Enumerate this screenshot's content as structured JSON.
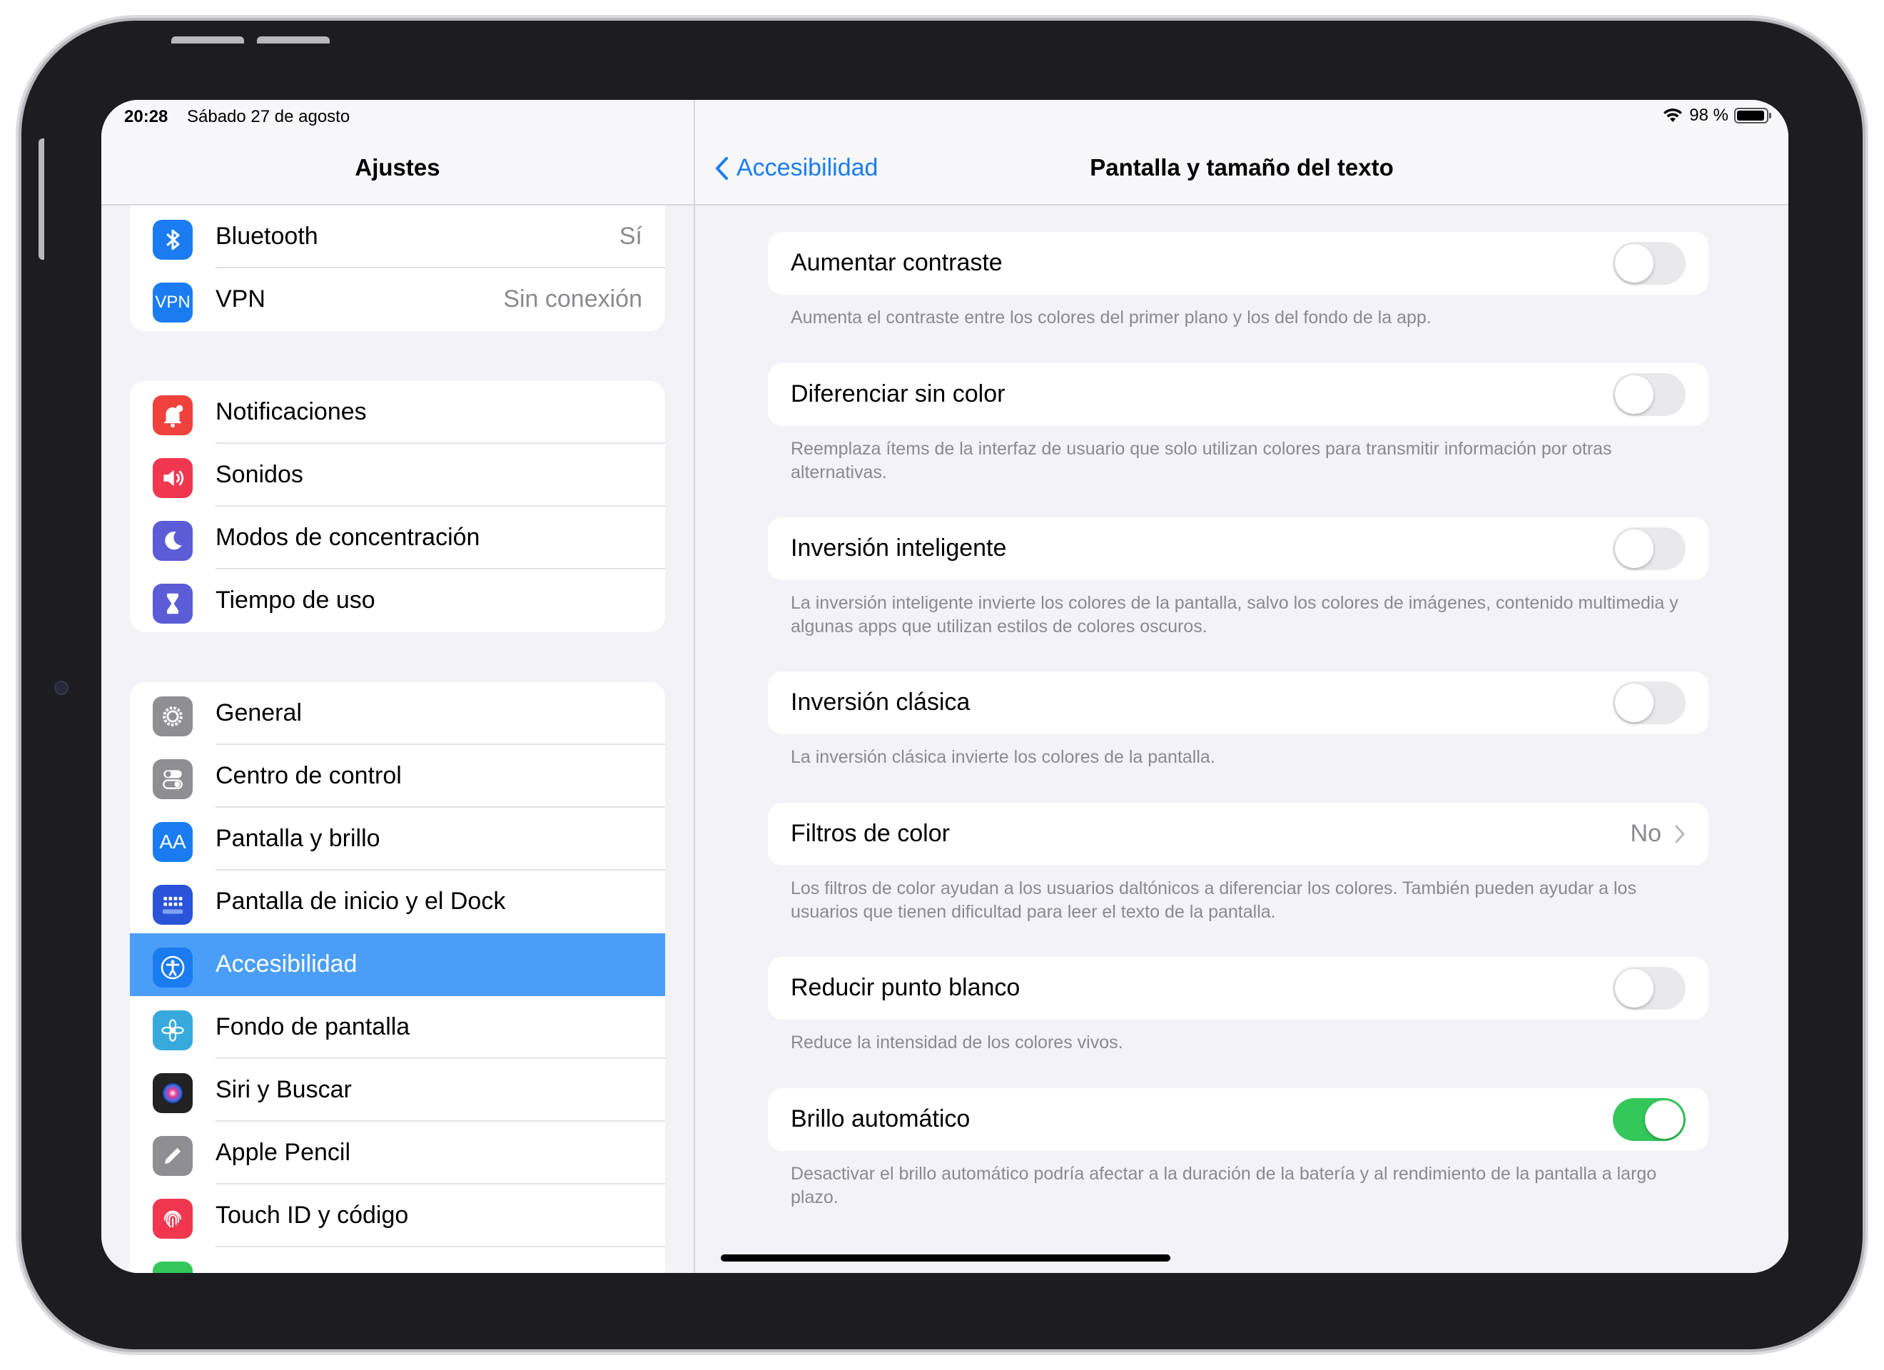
{
  "status": {
    "time": "20:28",
    "date": "Sábado 27 de agosto",
    "battery": "98 %"
  },
  "sidebar": {
    "title": "Ajustes",
    "groups": [
      {
        "items": [
          {
            "label": "Bluetooth",
            "value": "Sí",
            "icon": "bluetooth-icon",
            "color": "#1a7cf0"
          },
          {
            "label": "VPN",
            "value": "Sin conexión",
            "icon": "vpn-icon",
            "color": "#1a7cf0",
            "icon_text": "VPN"
          }
        ]
      },
      {
        "items": [
          {
            "label": "Notificaciones",
            "icon": "bell-icon",
            "color": "#f0423c"
          },
          {
            "label": "Sonidos",
            "icon": "speaker-icon",
            "color": "#f0374f"
          },
          {
            "label": "Modos de concentración",
            "icon": "moon-icon",
            "color": "#5b5cd6"
          },
          {
            "label": "Tiempo de uso",
            "icon": "hourglass-icon",
            "color": "#5b5cd6"
          }
        ]
      },
      {
        "items": [
          {
            "label": "General",
            "icon": "gear-icon",
            "color": "#8e8e93"
          },
          {
            "label": "Centro de control",
            "icon": "switches-icon",
            "color": "#8e8e93"
          },
          {
            "label": "Pantalla y brillo",
            "icon": "text-size-icon",
            "color": "#1a7cf0",
            "icon_text": "AA"
          },
          {
            "label": "Pantalla de inicio y el Dock",
            "icon": "grid-icon",
            "color": "#2b53d9"
          },
          {
            "label": "Accesibilidad",
            "icon": "accessibility-icon",
            "color": "#1a7cf0",
            "selected": true
          },
          {
            "label": "Fondo de pantalla",
            "icon": "flower-icon",
            "color": "#36aadc"
          },
          {
            "label": "Siri y Buscar",
            "icon": "siri-icon",
            "color": "#222222"
          },
          {
            "label": "Apple Pencil",
            "icon": "pencil-icon",
            "color": "#8e8e93"
          },
          {
            "label": "Touch ID y código",
            "icon": "fingerprint-icon",
            "color": "#f0374f"
          }
        ]
      }
    ]
  },
  "main": {
    "back_label": "Accesibilidad",
    "title": "Pantalla y tamaño del texto",
    "settings": [
      {
        "label": "Aumentar contraste",
        "type": "toggle",
        "on": false,
        "footer": "Aumenta el contraste entre los colores del primer plano y los del fondo de la app."
      },
      {
        "label": "Diferenciar sin color",
        "type": "toggle",
        "on": false,
        "footer": "Reemplaza ítems de la interfaz de usuario que solo utilizan colores para transmitir información por otras alternativas."
      },
      {
        "label": "Inversión inteligente",
        "type": "toggle",
        "on": false,
        "footer": "La inversión inteligente invierte los colores de la pantalla, salvo los colores de imágenes, contenido multimedia y algunas apps que utilizan estilos de colores oscuros."
      },
      {
        "label": "Inversión clásica",
        "type": "toggle",
        "on": false,
        "footer": "La inversión clásica invierte los colores de la pantalla."
      },
      {
        "label": "Filtros de color",
        "type": "link",
        "value": "No",
        "footer": "Los filtros de color ayudan a los usuarios daltónicos a diferenciar los colores. También pueden ayudar a los usuarios que tienen dificultad para leer el texto de la pantalla."
      },
      {
        "label": "Reducir punto blanco",
        "type": "toggle",
        "on": false,
        "footer": "Reduce la intensidad de los colores vivos."
      },
      {
        "label": "Brillo automático",
        "type": "toggle",
        "on": true,
        "footer": "Desactivar el brillo automático podría afectar a la duración de la batería y al rendimiento de la pantalla a largo plazo."
      }
    ]
  },
  "colors": {
    "accent": "#1a7cf0",
    "selected_row": "#4a9ef7",
    "toggle_on": "#34c759"
  }
}
